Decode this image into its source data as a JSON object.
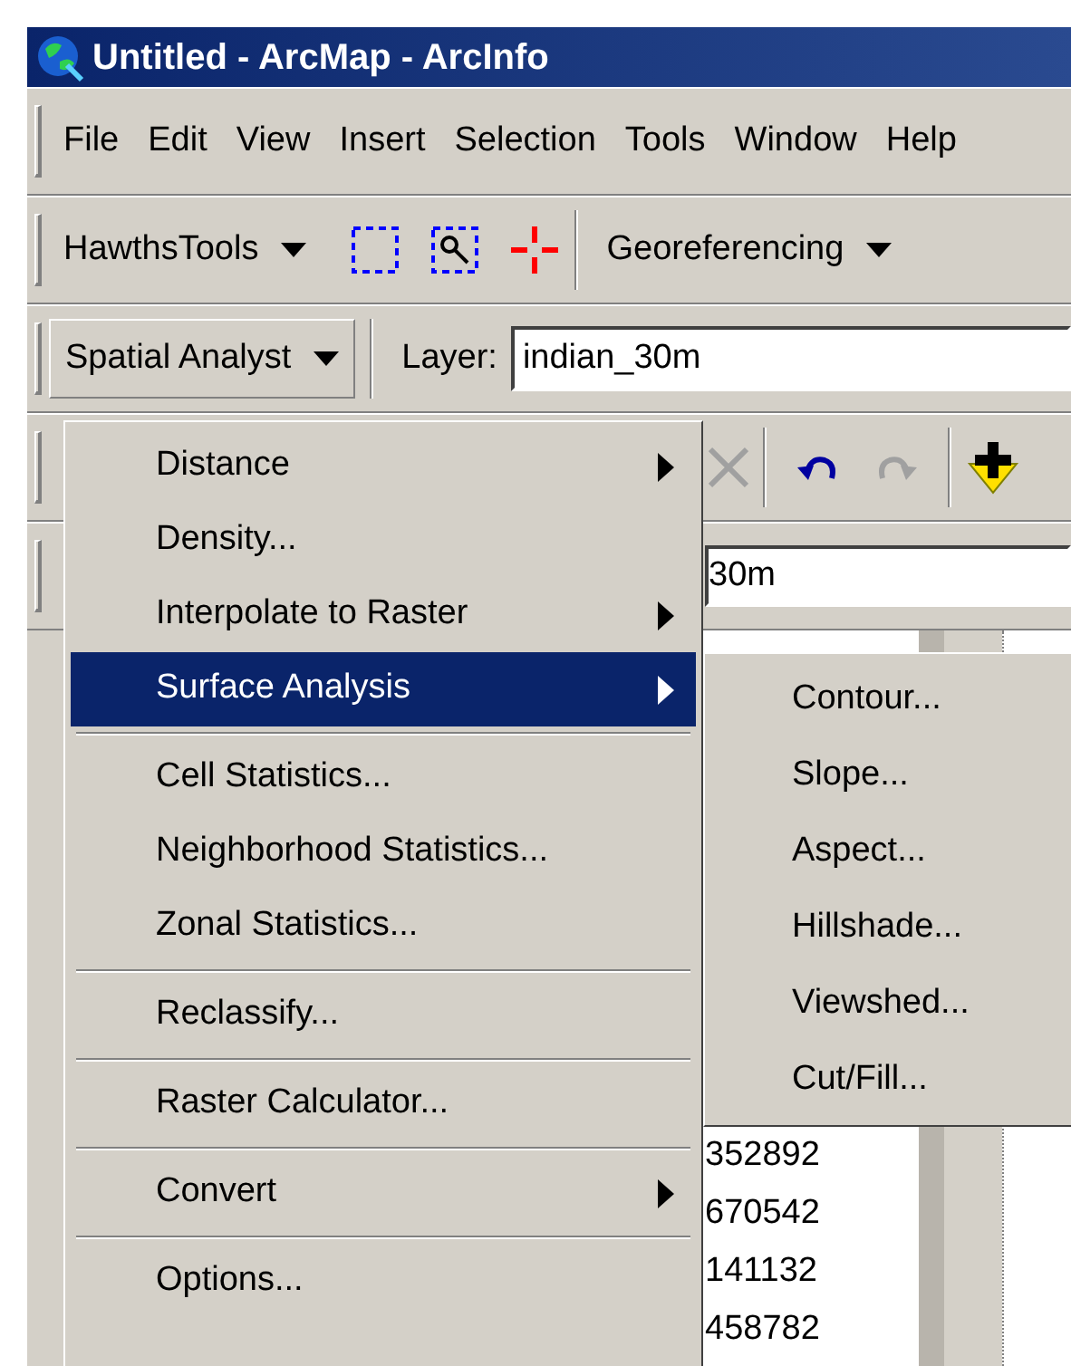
{
  "window": {
    "title": "Untitled - ArcMap - ArcInfo"
  },
  "menu_bar": [
    {
      "label": "File"
    },
    {
      "label": "Edit"
    },
    {
      "label": "View"
    },
    {
      "label": "Insert"
    },
    {
      "label": "Selection"
    },
    {
      "label": "Tools"
    },
    {
      "label": "Window"
    },
    {
      "label": "Help"
    }
  ],
  "hawths_toolbar": {
    "label": "HawthsTools"
  },
  "georeferencing": {
    "label": "Georeferencing"
  },
  "spatial_analyst": {
    "label": "Spatial Analyst"
  },
  "layer": {
    "label": "Layer:",
    "value": "indian_30m"
  },
  "second_field": {
    "value": "30m"
  },
  "menu": {
    "items": [
      {
        "kind": "item",
        "label": "Distance",
        "submenu": true,
        "selected": false
      },
      {
        "kind": "item",
        "label": "Density...",
        "submenu": false,
        "selected": false
      },
      {
        "kind": "item",
        "label": "Interpolate to Raster",
        "submenu": true,
        "selected": false
      },
      {
        "kind": "item",
        "label": "Surface Analysis",
        "submenu": true,
        "selected": true
      },
      {
        "kind": "separator"
      },
      {
        "kind": "item",
        "label": "Cell Statistics...",
        "submenu": false,
        "selected": false
      },
      {
        "kind": "item",
        "label": "Neighborhood Statistics...",
        "submenu": false,
        "selected": false
      },
      {
        "kind": "item",
        "label": "Zonal Statistics...",
        "submenu": false,
        "selected": false
      },
      {
        "kind": "separator"
      },
      {
        "kind": "item",
        "label": "Reclassify...",
        "submenu": false,
        "selected": false
      },
      {
        "kind": "separator"
      },
      {
        "kind": "item",
        "label": "Raster Calculator...",
        "submenu": false,
        "selected": false
      },
      {
        "kind": "separator"
      },
      {
        "kind": "item",
        "label": "Convert",
        "submenu": true,
        "selected": false
      },
      {
        "kind": "separator"
      },
      {
        "kind": "item",
        "label": "Options...",
        "submenu": false,
        "selected": false
      }
    ]
  },
  "submenu": {
    "items": [
      {
        "label": "Contour..."
      },
      {
        "label": "Slope..."
      },
      {
        "label": "Aspect..."
      },
      {
        "label": "Hillshade..."
      },
      {
        "label": "Viewshed..."
      },
      {
        "label": "Cut/Fill..."
      }
    ]
  },
  "table": {
    "values": [
      "352892",
      "670542",
      "141132",
      "458782"
    ]
  }
}
